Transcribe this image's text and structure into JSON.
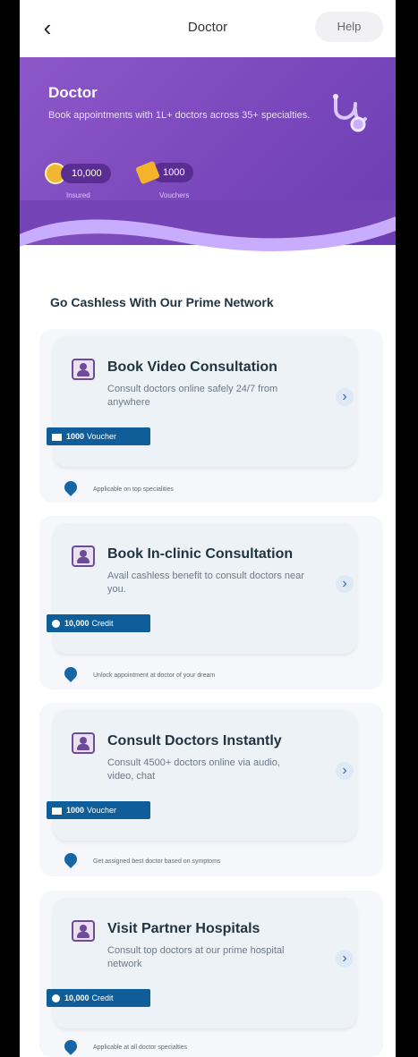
{
  "header": {
    "title": "Doctor",
    "help_label": "Help",
    "back_icon": "back-arrow-icon"
  },
  "hero": {
    "title": "Doctor",
    "subtitle": "Book appointments with 1L+ doctors across 35+ specialties.",
    "stats": [
      {
        "value": "10,000",
        "label": "Insured",
        "icon": "coin-icon",
        "color": "#f2b731"
      },
      {
        "value": "1000",
        "label": "Vouchers",
        "icon": "ticket-icon",
        "color": "#f3b32a"
      }
    ],
    "icon": "stethoscope-icon",
    "colors": {
      "primary": "#6b3cb2",
      "accent": "#8d57c8"
    }
  },
  "section_title": "Go Cashless With Our Prime Network",
  "cards": [
    {
      "title": "Book Video Consultation",
      "desc": "Consult doctors online safely 24/7 from anywhere",
      "badge_value": "1000",
      "badge_label": "Voucher",
      "badge_icon": "voucher-icon",
      "note": "Applicable on top specialities"
    },
    {
      "title": "Book In-clinic Consultation",
      "desc": "Avail cashless benefit to consult doctors near you.",
      "badge_value": "10,000",
      "badge_label": "Credit",
      "badge_icon": "credit-icon",
      "note": "Unlock appointment at doctor of your dream"
    },
    {
      "title": "Consult Doctors Instantly",
      "desc": "Consult 4500+ doctors online via audio, video, chat",
      "badge_value": "1000",
      "badge_label": "Voucher",
      "badge_icon": "voucher-icon",
      "note": "Get assigned best doctor based on symptoms"
    },
    {
      "title": "Visit Partner Hospitals",
      "desc": "Consult top doctors at our prime hospital network",
      "badge_value": "10,000",
      "badge_label": "Credit",
      "badge_icon": "credit-icon",
      "note": "Applicable at all doctor specialties"
    }
  ],
  "ui_icons": {
    "doctor": "doctor-icon",
    "arrow": "chevron-right-icon",
    "note": "drop-icon"
  }
}
